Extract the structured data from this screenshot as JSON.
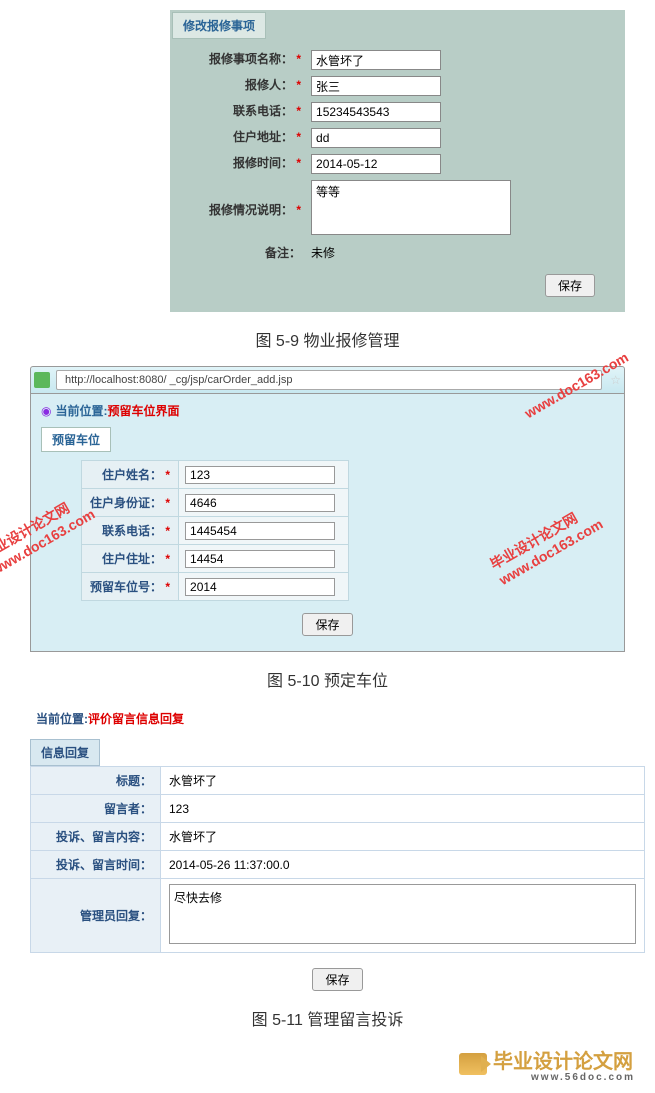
{
  "fig59": {
    "panel_title": "修改报修事项",
    "fields": {
      "name_label": "报修事项名称：",
      "name_value": "水管坏了",
      "reporter_label": "报修人：",
      "reporter_value": "张三",
      "phone_label": "联系电话：",
      "phone_value": "15234543543",
      "address_label": "住户地址：",
      "address_value": "dd",
      "time_label": "报修时间：",
      "time_value": "2014-05-12",
      "desc_label": "报修情况说明：",
      "desc_value": "等等",
      "remark_label": "备注：",
      "remark_value": "未修"
    },
    "required_mark": "*",
    "save_btn": "保存",
    "caption": "图 5-9  物业报修管理"
  },
  "fig510": {
    "url": "http://localhost:8080/ _cg/jsp/carOrder_add.jsp",
    "breadcrumb_label": "当前位置:",
    "breadcrumb_path": "预留车位界面",
    "tab_title": "预留车位",
    "fields": {
      "name_label": "住户姓名：",
      "name_value": "123",
      "id_label": "住户身份证：",
      "id_value": "4646",
      "phone_label": "联系电话：",
      "phone_value": "1445454",
      "address_label": "住户住址：",
      "address_value": "14454",
      "parking_label": "预留车位号：",
      "parking_value": "2014"
    },
    "required_mark": "*",
    "save_btn": "保存",
    "caption": "图 5-10 预定车位",
    "watermark_text1": "毕业设计论文网",
    "watermark_text2": "www.doc163.com"
  },
  "fig511": {
    "breadcrumb_label": "当前位置:",
    "breadcrumb_path": "评价留言信息回复",
    "panel_title": "信息回复",
    "fields": {
      "title_label": "标题：",
      "title_value": "水管坏了",
      "author_label": "留言者：",
      "author_value": "123",
      "content_label": "投诉、留言内容：",
      "content_value": "水管坏了",
      "time_label": "投诉、留言时间：",
      "time_value": "2014-05-26 11:37:00.0",
      "reply_label": "管理员回复：",
      "reply_value": "尽快去修"
    },
    "save_btn": "保存",
    "caption": "图 5-11   管理留言投诉"
  },
  "footer": {
    "name": "毕业设计论文网",
    "url": "www.56doc.com"
  }
}
